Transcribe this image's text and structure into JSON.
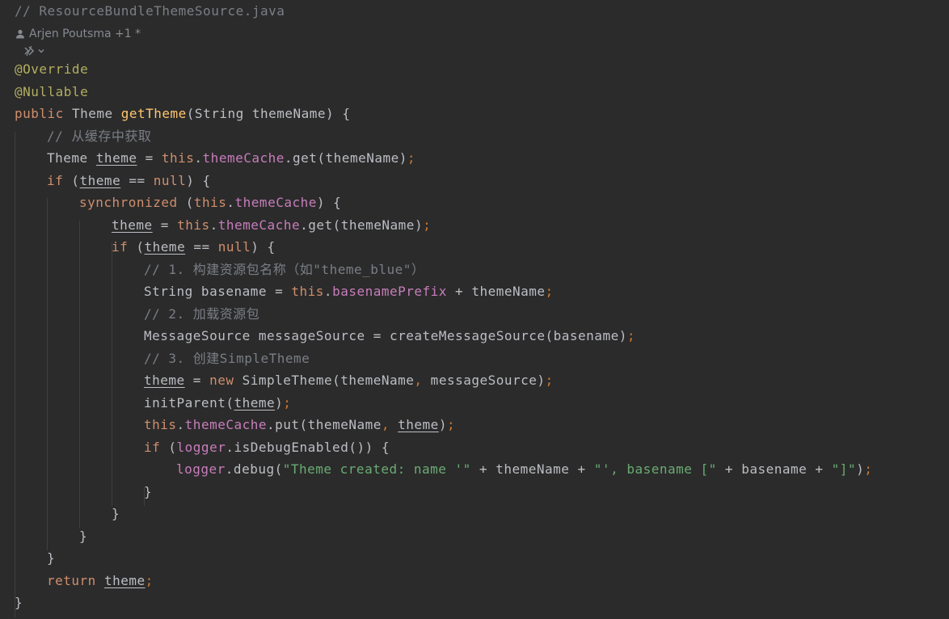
{
  "editor": {
    "file_comment": "// ResourceBundleThemeSource.java",
    "author_hint": "Arjen Poutsma +1 *",
    "lines": [
      {
        "tokens": [
          {
            "t": "@Override",
            "k": "ann"
          }
        ]
      },
      {
        "tokens": [
          {
            "t": "@Nullable",
            "k": "ann"
          }
        ]
      },
      {
        "tokens": [
          {
            "t": "public ",
            "k": "kw"
          },
          {
            "t": "Theme ",
            "k": "plain"
          },
          {
            "t": "getTheme",
            "k": "decl"
          },
          {
            "t": "(String themeName) {",
            "k": "plain"
          }
        ]
      },
      {
        "indent": 1,
        "tokens": [
          {
            "t": "// 从缓存中获取",
            "k": "comment"
          }
        ]
      },
      {
        "indent": 1,
        "tokens": [
          {
            "t": "Theme ",
            "k": "plain"
          },
          {
            "t": "theme",
            "k": "plain",
            "u": true
          },
          {
            "t": " = ",
            "k": "plain"
          },
          {
            "t": "this",
            "k": "kw"
          },
          {
            "t": ".",
            "k": "plain"
          },
          {
            "t": "themeCache",
            "k": "field"
          },
          {
            "t": ".get(themeName)",
            "k": "plain"
          },
          {
            "t": ";",
            "k": "semi"
          }
        ]
      },
      {
        "indent": 1,
        "tokens": [
          {
            "t": "if",
            "k": "kw"
          },
          {
            "t": " (",
            "k": "plain"
          },
          {
            "t": "theme",
            "k": "plain",
            "u": true
          },
          {
            "t": " == ",
            "k": "plain"
          },
          {
            "t": "null",
            "k": "kw"
          },
          {
            "t": ") {",
            "k": "plain"
          }
        ]
      },
      {
        "indent": 2,
        "tokens": [
          {
            "t": "synchronized",
            "k": "kw"
          },
          {
            "t": " (",
            "k": "plain"
          },
          {
            "t": "this",
            "k": "kw"
          },
          {
            "t": ".",
            "k": "plain"
          },
          {
            "t": "themeCache",
            "k": "field"
          },
          {
            "t": ") {",
            "k": "plain"
          }
        ]
      },
      {
        "indent": 3,
        "tokens": [
          {
            "t": "theme",
            "k": "plain",
            "u": true
          },
          {
            "t": " = ",
            "k": "plain"
          },
          {
            "t": "this",
            "k": "kw"
          },
          {
            "t": ".",
            "k": "plain"
          },
          {
            "t": "themeCache",
            "k": "field"
          },
          {
            "t": ".get(themeName)",
            "k": "plain"
          },
          {
            "t": ";",
            "k": "semi"
          }
        ]
      },
      {
        "indent": 3,
        "tokens": [
          {
            "t": "if",
            "k": "kw"
          },
          {
            "t": " (",
            "k": "plain"
          },
          {
            "t": "theme",
            "k": "plain",
            "u": true
          },
          {
            "t": " == ",
            "k": "plain"
          },
          {
            "t": "null",
            "k": "kw"
          },
          {
            "t": ") {",
            "k": "plain"
          }
        ]
      },
      {
        "indent": 4,
        "tokens": [
          {
            "t": "// 1. 构建资源包名称（如\"theme_blue\"）",
            "k": "comment"
          }
        ]
      },
      {
        "indent": 4,
        "tokens": [
          {
            "t": "String basename = ",
            "k": "plain"
          },
          {
            "t": "this",
            "k": "kw"
          },
          {
            "t": ".",
            "k": "plain"
          },
          {
            "t": "basenamePrefix",
            "k": "field"
          },
          {
            "t": " + themeName",
            "k": "plain"
          },
          {
            "t": ";",
            "k": "semi"
          }
        ]
      },
      {
        "indent": 4,
        "tokens": [
          {
            "t": "// 2. 加载资源包",
            "k": "comment"
          }
        ]
      },
      {
        "indent": 4,
        "tokens": [
          {
            "t": "MessageSource messageSource = createMessageSource(basename)",
            "k": "plain"
          },
          {
            "t": ";",
            "k": "semi"
          }
        ]
      },
      {
        "indent": 4,
        "tokens": [
          {
            "t": "// 3. 创建SimpleTheme",
            "k": "comment"
          }
        ]
      },
      {
        "indent": 4,
        "tokens": [
          {
            "t": "theme",
            "k": "plain",
            "u": true
          },
          {
            "t": " = ",
            "k": "plain"
          },
          {
            "t": "new",
            "k": "kw"
          },
          {
            "t": " SimpleTheme(themeName",
            "k": "plain"
          },
          {
            "t": ",",
            "k": "semi"
          },
          {
            "t": " messageSource)",
            "k": "plain"
          },
          {
            "t": ";",
            "k": "semi"
          }
        ]
      },
      {
        "indent": 4,
        "tokens": [
          {
            "t": "initParent(",
            "k": "plain"
          },
          {
            "t": "theme",
            "k": "plain",
            "u": true
          },
          {
            "t": ")",
            "k": "plain"
          },
          {
            "t": ";",
            "k": "semi"
          }
        ]
      },
      {
        "indent": 4,
        "tokens": [
          {
            "t": "this",
            "k": "kw"
          },
          {
            "t": ".",
            "k": "plain"
          },
          {
            "t": "themeCache",
            "k": "field"
          },
          {
            "t": ".put(themeName",
            "k": "plain"
          },
          {
            "t": ",",
            "k": "semi"
          },
          {
            "t": " ",
            "k": "plain"
          },
          {
            "t": "theme",
            "k": "plain",
            "u": true
          },
          {
            "t": ")",
            "k": "plain"
          },
          {
            "t": ";",
            "k": "semi"
          }
        ]
      },
      {
        "indent": 4,
        "tokens": [
          {
            "t": "if",
            "k": "kw"
          },
          {
            "t": " (",
            "k": "plain"
          },
          {
            "t": "logger",
            "k": "field"
          },
          {
            "t": ".isDebugEnabled()) {",
            "k": "plain"
          }
        ]
      },
      {
        "indent": 5,
        "tokens": [
          {
            "t": "logger",
            "k": "field"
          },
          {
            "t": ".debug(",
            "k": "plain"
          },
          {
            "t": "\"Theme created: name '\"",
            "k": "str"
          },
          {
            "t": " + themeName + ",
            "k": "plain"
          },
          {
            "t": "\"', basename [\"",
            "k": "str"
          },
          {
            "t": " + basename + ",
            "k": "plain"
          },
          {
            "t": "\"]\"",
            "k": "str"
          },
          {
            "t": ")",
            "k": "plain"
          },
          {
            "t": ";",
            "k": "semi"
          }
        ]
      },
      {
        "indent": 4,
        "tokens": [
          {
            "t": "}",
            "k": "plain"
          }
        ]
      },
      {
        "indent": 3,
        "tokens": [
          {
            "t": "}",
            "k": "plain"
          }
        ]
      },
      {
        "indent": 2,
        "tokens": [
          {
            "t": "}",
            "k": "plain"
          }
        ]
      },
      {
        "indent": 1,
        "tokens": [
          {
            "t": "}",
            "k": "plain"
          }
        ]
      },
      {
        "indent": 1,
        "tokens": [
          {
            "t": "return",
            "k": "kw"
          },
          {
            "t": " ",
            "k": "plain"
          },
          {
            "t": "theme",
            "k": "plain",
            "u": true
          },
          {
            "t": ";",
            "k": "semi"
          }
        ]
      },
      {
        "tokens": [
          {
            "t": "}",
            "k": "plain"
          }
        ]
      }
    ]
  },
  "icons": {
    "author": "person-icon",
    "inlay": "code-vision-icon",
    "chevron": "chevron-down-icon"
  }
}
